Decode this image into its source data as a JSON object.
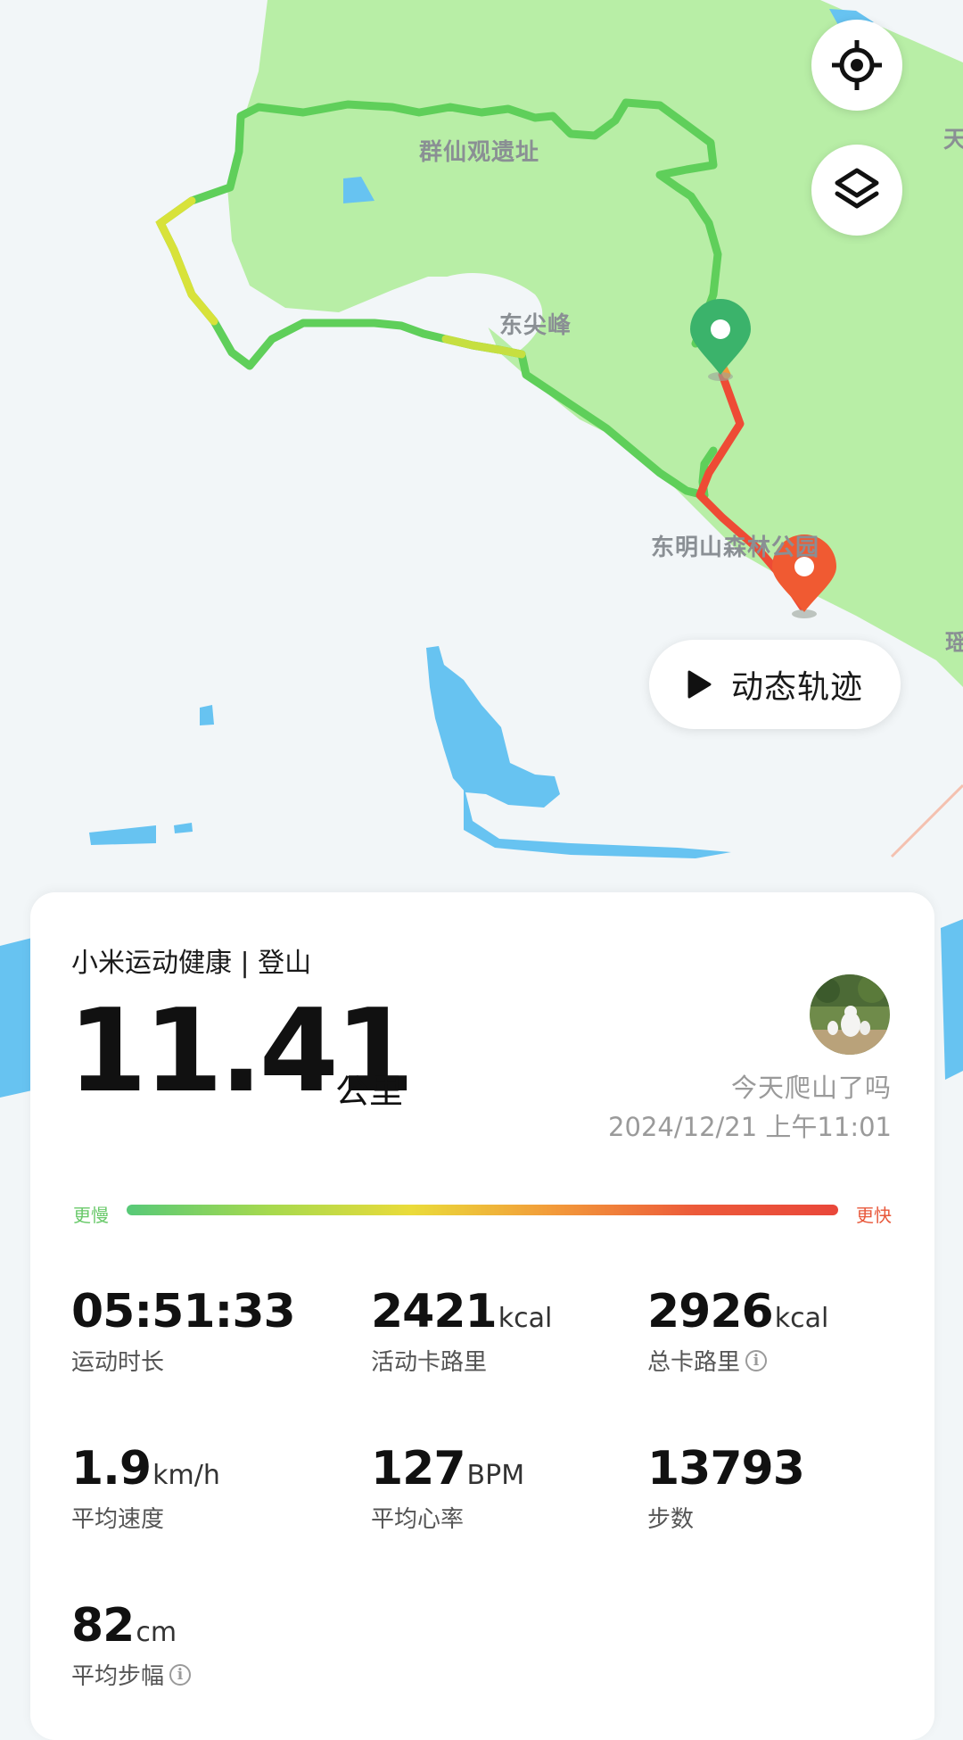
{
  "map": {
    "labels": {
      "qunxian": "群仙观遗址",
      "dongjianfeng": "东尖峰",
      "dongmingshan": "东明山森林公园",
      "edge_top": "天",
      "edge_bottom": "瑶"
    },
    "icons": {
      "locate": "locate-target-icon",
      "layers": "layers-icon",
      "start": "start-pin-icon",
      "end": "end-pin-icon"
    },
    "replay_label": "动态轨迹"
  },
  "summary": {
    "app_title": "小米运动健康 | 登山",
    "distance": "11.41",
    "distance_unit": "公里",
    "motto": "今天爬山了吗",
    "datetime": "2024/12/21 上午11:01"
  },
  "pace_legend": {
    "slow": "更慢",
    "fast": "更快"
  },
  "stats": [
    {
      "value": "05:51:33",
      "unit": "",
      "label": "运动时长"
    },
    {
      "value": "2421",
      "unit": "kcal",
      "label": "活动卡路里"
    },
    {
      "value": "2926",
      "unit": "kcal",
      "label": "总卡路里"
    },
    {
      "value": "1.9",
      "unit": "km/h",
      "label": "平均速度"
    },
    {
      "value": "127",
      "unit": "BPM",
      "label": "平均心率"
    },
    {
      "value": "13793",
      "unit": "",
      "label": "步数"
    },
    {
      "value": "82",
      "unit": "cm",
      "label": "平均步幅"
    }
  ],
  "colors": {
    "route_green": "#5fcf5a",
    "route_red": "#ee4b35",
    "park_green": "#b8eea6",
    "water": "#67c3f1"
  }
}
